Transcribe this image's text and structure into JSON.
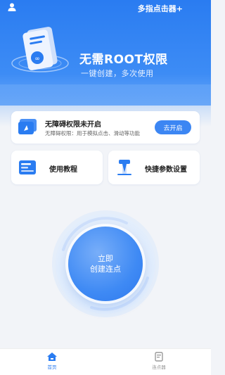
{
  "header": {
    "app_title": "多指点击器+",
    "icon": "user-icon"
  },
  "hero": {
    "title": "无需ROOT权限",
    "subtitle": "一键创建，多次使用",
    "illustration": "document-phone-illustration"
  },
  "accessibility": {
    "title": "无障碍权限未开启",
    "description": "无障碍权限：用于模拟点击、滑动等功能",
    "button_label": "去开启",
    "icon": "screen-pointer-icon"
  },
  "tiles": [
    {
      "label": "使用教程",
      "icon": "tutorial-icon"
    },
    {
      "label": "快捷参数设置",
      "icon": "settings-clip-icon"
    }
  ],
  "start": {
    "line1": "立即",
    "line2": "创建连点"
  },
  "tabs": [
    {
      "label": "首页",
      "icon": "home-icon",
      "active": true
    },
    {
      "label": "连点器",
      "icon": "clicker-doc-icon",
      "active": false
    }
  ],
  "colors": {
    "primary": "#2a7cf1",
    "background": "#f2f4f8",
    "inactive": "#999999"
  }
}
